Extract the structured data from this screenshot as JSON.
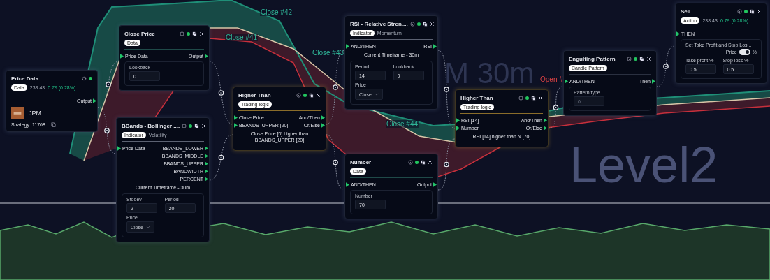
{
  "chart_labels": [
    {
      "text": "Close #42",
      "kind": "close"
    },
    {
      "text": "Close #41",
      "kind": "close"
    },
    {
      "text": "Close #43",
      "kind": "close"
    },
    {
      "text": "Close #44",
      "kind": "close"
    },
    {
      "text": "Open #",
      "kind": "open"
    }
  ],
  "watermarks": [
    "M 30m",
    "Level2"
  ],
  "nodes": [
    {
      "title": "Price Data",
      "closable": false,
      "active": true,
      "tag": "Data",
      "quote": {
        "price": "238.43",
        "change": "0.79 (0.28%)"
      },
      "color": "#1f4a48",
      "sections": [
        {
          "kind": "port",
          "right": "Output"
        },
        {
          "kind": "asset",
          "symbol": "JPM"
        },
        {
          "kind": "strategy",
          "text": "Strategy: 11768"
        }
      ]
    },
    {
      "title": "Close Price",
      "closable": true,
      "active": true,
      "tag": "Data",
      "color": "#1f4a48",
      "sections": [
        {
          "kind": "port",
          "left": "Price Data",
          "right": "Output"
        },
        {
          "kind": "panel",
          "fields": [
            {
              "kind": "input",
              "label": "Lookback",
              "value": "0"
            }
          ]
        }
      ]
    },
    {
      "title": "BBands - Bollinger ....",
      "closable": true,
      "active": true,
      "tag": "Indicator",
      "subtag": "Volatility",
      "color": "#5c6272",
      "sections": [
        {
          "kind": "port",
          "left": "Price Data",
          "right": "BBANDS_LOWER"
        },
        {
          "kind": "port",
          "right": "BBANDS_MIDDLE"
        },
        {
          "kind": "port",
          "right": "BBANDS_UPPER"
        },
        {
          "kind": "port",
          "right": "BANDWIDTH"
        },
        {
          "kind": "port",
          "right": "PERCENT"
        },
        {
          "kind": "note",
          "text": "Current Timeframe - 30m"
        },
        {
          "kind": "panel",
          "fields": [
            {
              "kind": "input",
              "label": "Stddev",
              "value": "2"
            },
            {
              "kind": "input",
              "label": "Period",
              "value": "20"
            },
            {
              "kind": "select",
              "label": "Price",
              "value": "Close"
            }
          ]
        }
      ]
    },
    {
      "title": "Higher Than",
      "closable": true,
      "active": true,
      "tag": "Trading logic",
      "color": "#8a6d2a",
      "sections": [
        {
          "kind": "port",
          "left": "Close Price",
          "right": "And/Then"
        },
        {
          "kind": "port",
          "left": "BBANDS_UPPER [20]",
          "right": "Or/Else"
        },
        {
          "kind": "note",
          "text": "Close Price [0] higher than BBANDS_UPPER [20]"
        }
      ]
    },
    {
      "title": "RSI - Relative Stren....",
      "closable": true,
      "active": true,
      "tag": "Indicator",
      "subtag": "Momentum",
      "color": "#5c6272",
      "sections": [
        {
          "kind": "port",
          "left": "AND/THEN",
          "right": "RSI"
        },
        {
          "kind": "note",
          "text": "Current Timeframe - 30m"
        },
        {
          "kind": "panel",
          "fields": [
            {
              "kind": "input",
              "label": "Period",
              "value": "14"
            },
            {
              "kind": "input",
              "label": "Lookback",
              "value": "0"
            },
            {
              "kind": "select",
              "label": "Price",
              "value": "Close"
            }
          ]
        }
      ]
    },
    {
      "title": "Number",
      "closable": true,
      "active": true,
      "tag": "Data",
      "color": "#1f4a48",
      "sections": [
        {
          "kind": "port",
          "left": "AND/THEN",
          "right": "Output"
        },
        {
          "kind": "panel",
          "fields": [
            {
              "kind": "input",
              "label": "Number",
              "value": "70"
            }
          ]
        }
      ]
    },
    {
      "title": "Higher Than",
      "closable": true,
      "active": true,
      "tag": "Trading logic",
      "color": "#8a6d2a",
      "sections": [
        {
          "kind": "port",
          "left": "RSI [14]",
          "right": "And/Then"
        },
        {
          "kind": "port",
          "left": "Number",
          "right": "Or/Else"
        },
        {
          "kind": "note",
          "text": "RSI [14] higher than N [70]"
        }
      ]
    },
    {
      "title": "Engulfing Pattern",
      "closable": true,
      "active": true,
      "tag": "Candle Pattern",
      "color": "#2a3040",
      "sections": [
        {
          "kind": "port",
          "left": "AND/THEN",
          "right": "Then"
        },
        {
          "kind": "panel",
          "fields": [
            {
              "kind": "input",
              "label": "Pattern type",
              "placeholder": "0"
            }
          ]
        }
      ]
    },
    {
      "title": "Sell",
      "closable": true,
      "active": true,
      "tag": "Action",
      "quote": {
        "price": "238.43",
        "change": "0.79 (0.28%)"
      },
      "color": "#7a2a38",
      "sections": [
        {
          "kind": "port",
          "left": "THEN"
        },
        {
          "kind": "panel",
          "toggle": {
            "label": "Set Take Profit and Stop Los...",
            "before": "Price",
            "after": "%",
            "on": true
          },
          "fields": [
            {
              "kind": "input",
              "label": "Take profit %",
              "value": "0.5"
            },
            {
              "kind": "input",
              "label": "Stop loss %",
              "value": "0.5"
            }
          ]
        }
      ]
    }
  ]
}
